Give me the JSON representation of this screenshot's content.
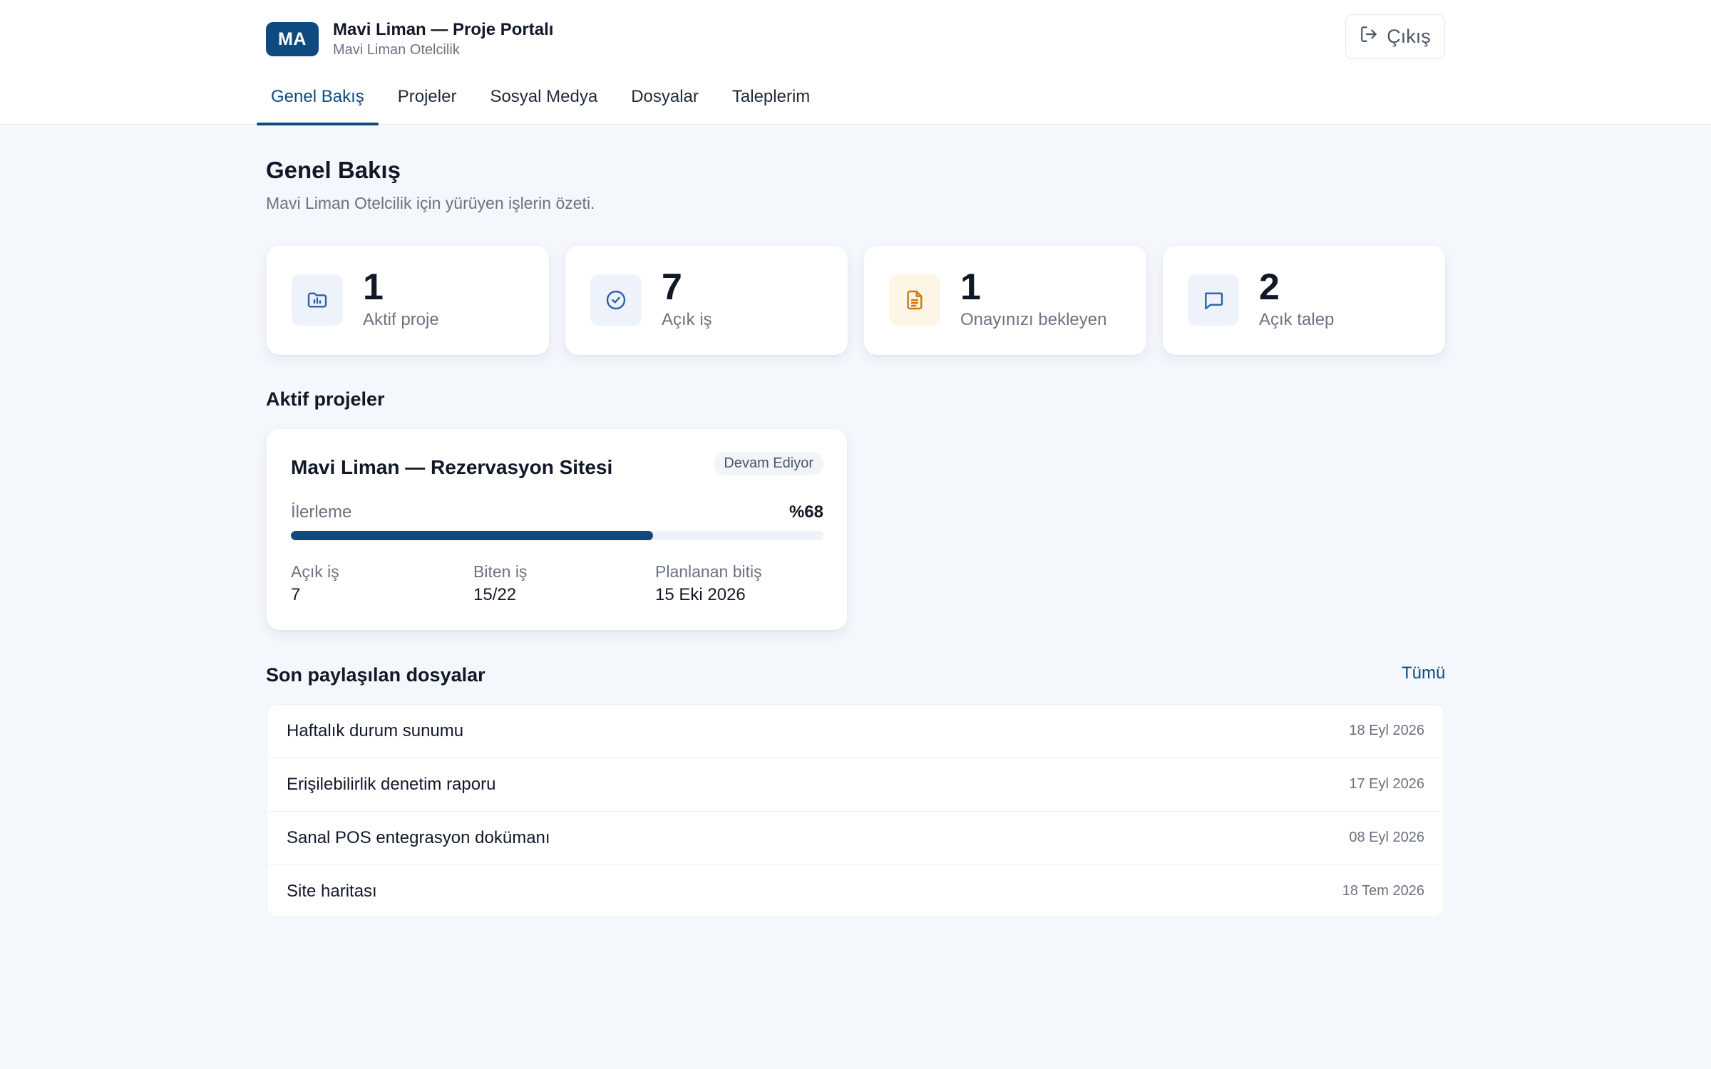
{
  "header": {
    "avatar_initials": "MA",
    "title": "Mavi Liman — Proje Portalı",
    "subtitle": "Mavi Liman Otelcilik",
    "logout_label": "Çıkış"
  },
  "tabs": [
    {
      "label": "Genel Bakış",
      "active": true
    },
    {
      "label": "Projeler",
      "active": false
    },
    {
      "label": "Sosyal Medya",
      "active": false
    },
    {
      "label": "Dosyalar",
      "active": false
    },
    {
      "label": "Taleplerim",
      "active": false
    }
  ],
  "page": {
    "title": "Genel Bakış",
    "subtitle": "Mavi Liman Otelcilik için yürüyen işlerin özeti."
  },
  "stats": [
    {
      "value": "1",
      "label": "Aktif proje",
      "icon": "folder-chart-icon",
      "icon_color": "#2f5fa8",
      "icon_bg": "#eef3fb"
    },
    {
      "value": "7",
      "label": "Açık iş",
      "icon": "check-circle-icon",
      "icon_color": "#2f5fa8",
      "icon_bg": "#eef3fb"
    },
    {
      "value": "1",
      "label": "Onayınızı bekleyen",
      "icon": "document-icon",
      "icon_color": "#c97a10",
      "icon_bg": "#fdf5e6"
    },
    {
      "value": "2",
      "label": "Açık talep",
      "icon": "message-icon",
      "icon_color": "#2f5fa8",
      "icon_bg": "#eef3fb"
    }
  ],
  "active_projects": {
    "title": "Aktif projeler",
    "project": {
      "name": "Mavi Liman — Rezervasyon Sitesi",
      "status": "Devam Ediyor",
      "progress_label": "İlerleme",
      "progress_text": "%68",
      "progress_percent": 68,
      "open_tasks_label": "Açık iş",
      "open_tasks_value": "7",
      "done_tasks_label": "Biten iş",
      "done_tasks_value": "15/22",
      "planned_end_label": "Planlanan bitiş",
      "planned_end_value": "15 Eki 2026"
    }
  },
  "recent_files": {
    "title": "Son paylaşılan dosyalar",
    "all_label": "Tümü",
    "items": [
      {
        "name": "Haftalık durum sunumu",
        "date": "18 Eyl 2026"
      },
      {
        "name": "Erişilebilirlik denetim raporu",
        "date": "17 Eyl 2026"
      },
      {
        "name": "Sanal POS entegrasyon dokümanı",
        "date": "08 Eyl 2026"
      },
      {
        "name": "Site haritası",
        "date": "18 Tem 2026"
      }
    ]
  },
  "colors": {
    "accent": "#0e4a7f",
    "background": "#f4f7fc"
  }
}
